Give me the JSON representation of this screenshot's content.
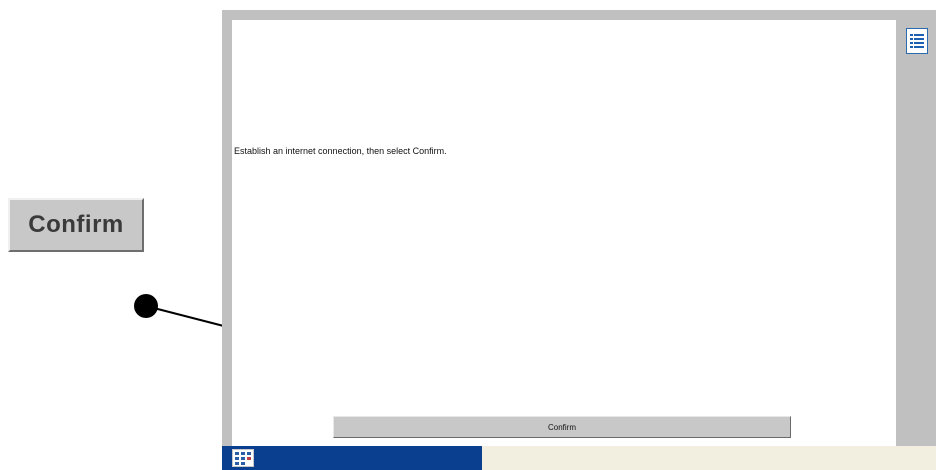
{
  "callout": {
    "button_label": "Confirm"
  },
  "app": {
    "instruction": "Establish an internet connection, then select Confirm.",
    "confirm_label": "Confirm",
    "menu_icon": "list-menu-icon"
  },
  "taskbar": {
    "start_icon": "calculator-icon"
  },
  "colors": {
    "frame": "#c0c0c0",
    "taskbar_blue": "#0a3f8f",
    "taskbar_bg": "#f2efe0",
    "button_face": "#c8c8c8"
  }
}
